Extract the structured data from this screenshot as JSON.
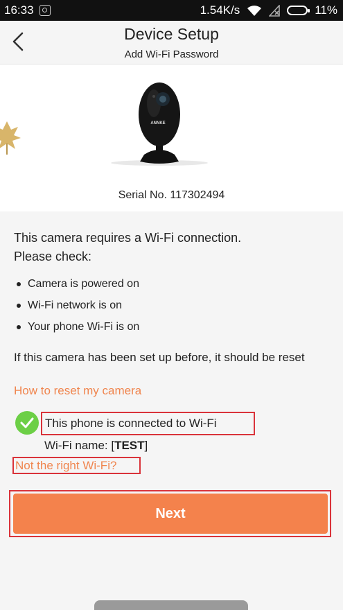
{
  "status_bar": {
    "time": "16:33",
    "network_speed": "1.54K/s",
    "battery": "11%",
    "icons": [
      "notification-icon",
      "wifi-icon",
      "no-sim-icon",
      "battery-icon"
    ]
  },
  "header": {
    "title": "Device Setup",
    "subtitle": "Add Wi-Fi Password",
    "back_icon": "chevron-left-icon"
  },
  "product": {
    "serial": "Serial No. 117302494",
    "camera_brand": "ANNKE"
  },
  "requirements": {
    "line1": "This camera requires a Wi-Fi connection.",
    "line2": "Please check:",
    "items": [
      "Camera is powered on",
      "Wi-Fi network is on",
      "Your phone Wi-Fi is on"
    ]
  },
  "reset": {
    "note": "If this camera has been set up before, it should be reset",
    "link": "How to reset my camera"
  },
  "wifi": {
    "connected_text": "This phone is connected to Wi-Fi",
    "name_label": "Wi-Fi name: [",
    "name_value": "TEST",
    "name_suffix": "]",
    "wrong_link": "Not the right Wi-Fi?"
  },
  "actions": {
    "next_label": "Next"
  },
  "colors": {
    "accent": "#f4824c",
    "link": "#f0854e",
    "success": "#6ccf46",
    "highlight": "#d9333a"
  }
}
